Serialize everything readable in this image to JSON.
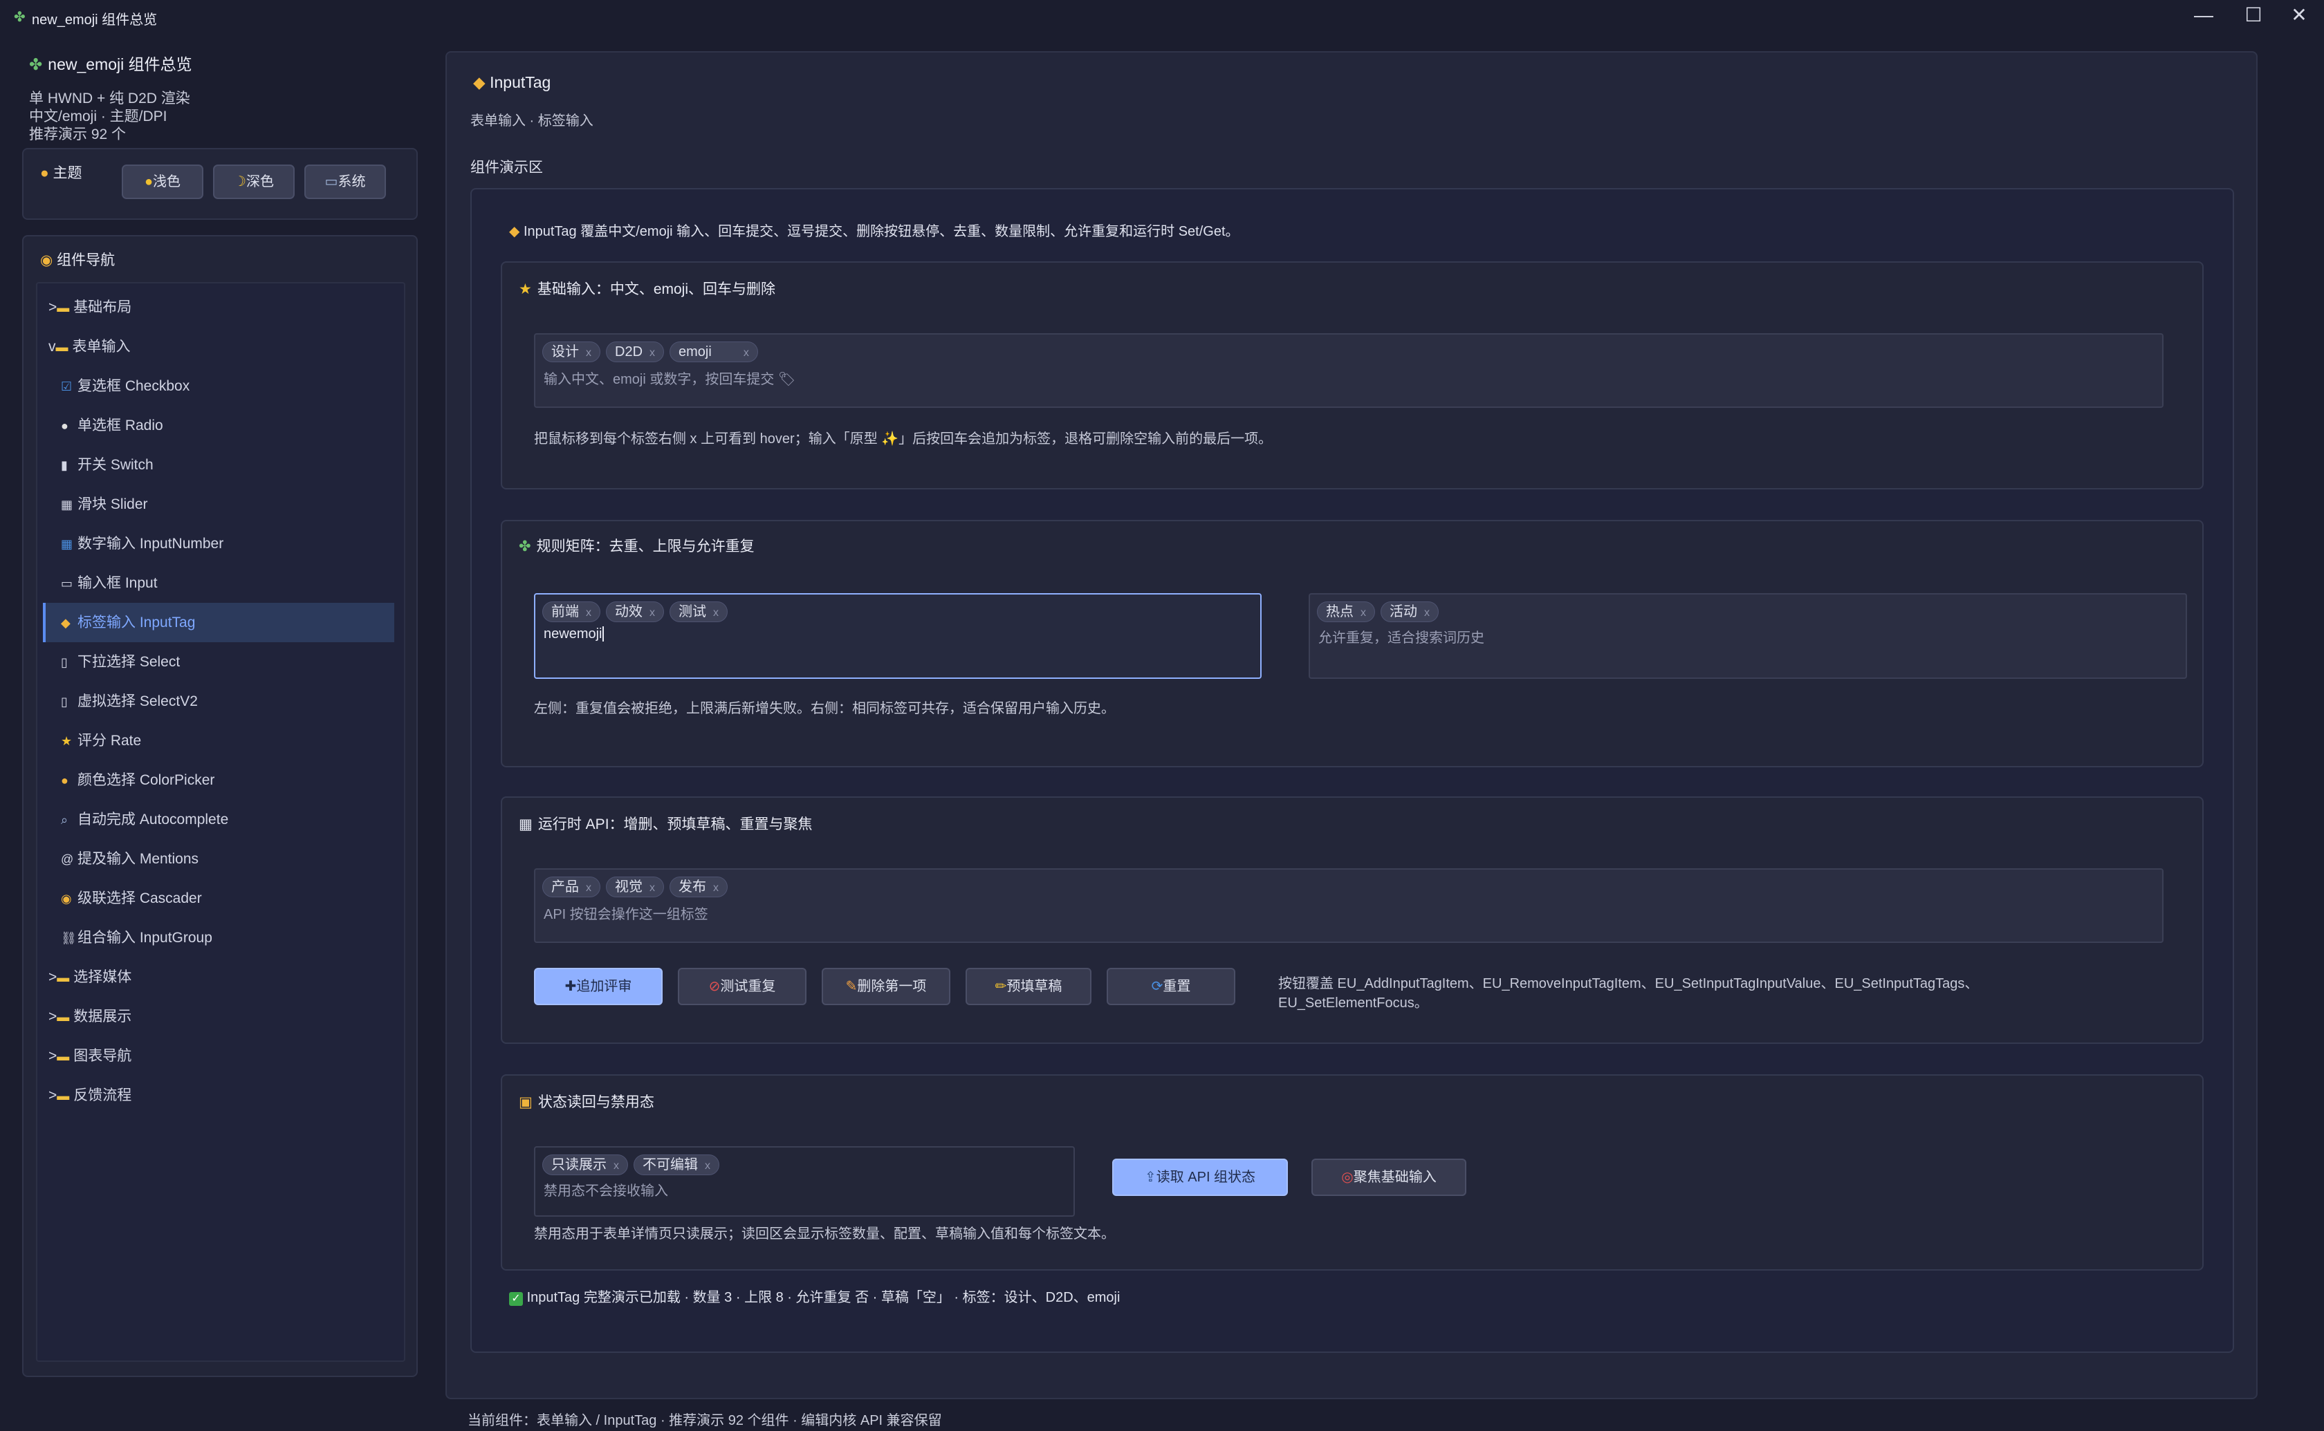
{
  "window": {
    "title": "new_emoji 组件总览",
    "minimize": "—",
    "maximize": "☐",
    "close": "✕"
  },
  "sidebar": {
    "app_title": "new_emoji 组件总览",
    "info_lines": [
      "单 HWND + 纯 D2D 渲染",
      "中文/emoji · 主题/DPI",
      "推荐演示 92 个"
    ],
    "theme": {
      "label": "主题",
      "buttons": [
        "浅色",
        "深色",
        "系统"
      ]
    },
    "nav": {
      "label": "组件导航",
      "items": [
        {
          "prefix": ">",
          "icon": "📁",
          "label": "基础布局"
        },
        {
          "prefix": "v",
          "icon": "📁",
          "label": "表单输入"
        },
        {
          "icon": "☑",
          "label": "复选框 Checkbox"
        },
        {
          "icon": "⚪",
          "label": "单选框 Radio"
        },
        {
          "icon": "▮",
          "label": "开关 Switch"
        },
        {
          "icon": "▦",
          "label": "滑块 Slider"
        },
        {
          "icon": "🔢",
          "label": "数字输入 InputNumber"
        },
        {
          "icon": "▭",
          "label": "输入框 Input"
        },
        {
          "icon": "🏷",
          "label": "标签输入 InputTag"
        },
        {
          "icon": "▯",
          "label": "下拉选择 Select"
        },
        {
          "icon": "▯",
          "label": "虚拟选择 SelectV2"
        },
        {
          "icon": "★",
          "label": "评分 Rate"
        },
        {
          "icon": "🎨",
          "label": "颜色选择 ColorPicker"
        },
        {
          "icon": "🔎",
          "label": "自动完成 Autocomplete"
        },
        {
          "icon": "@",
          "label": "提及输入 Mentions"
        },
        {
          "icon": "🧭",
          "label": "级联选择 Cascader"
        },
        {
          "icon": "🔗",
          "label": "组合输入 InputGroup"
        },
        {
          "prefix": ">",
          "icon": "📁",
          "label": "选择媒体"
        },
        {
          "prefix": ">",
          "icon": "📁",
          "label": "数据展示"
        },
        {
          "prefix": ">",
          "icon": "📁",
          "label": "图表导航"
        },
        {
          "prefix": ">",
          "icon": "📁",
          "label": "反馈流程"
        }
      ]
    }
  },
  "main": {
    "title": "InputTag",
    "subtitle": "表单输入 · 标签输入",
    "demo_label": "组件演示区",
    "intro": "InputTag 覆盖中文/emoji 输入、回车提交、逗号提交、删除按钮悬停、去重、数量限制、允许重复和运行时 Set/Get。",
    "sections": {
      "basic": {
        "title": "基础输入：中文、emoji、回车与删除",
        "tags": [
          "设计",
          "D2D",
          "emoji"
        ],
        "placeholder": "输入中文、emoji 或数字，按回车提交 🏷",
        "hint": "把鼠标移到每个标签右侧 x 上可看到 hover；输入「原型 ✨」后按回车会追加为标签，退格可删除空输入前的最后一项。"
      },
      "rules": {
        "title": "规则矩阵：去重、上限与允许重复",
        "left_tags": [
          "前端",
          "动效",
          "测试"
        ],
        "left_value": "newemoji",
        "right_tags": [
          "热点",
          "活动"
        ],
        "right_placeholder": "允许重复，适合搜索词历史",
        "hint": "左侧：重复值会被拒绝，上限满后新增失败。右侧：相同标签可共存，适合保留用户输入历史。"
      },
      "api": {
        "title": "运行时 API：增删、预填草稿、重置与聚焦",
        "tags": [
          "产品",
          "视觉",
          "发布"
        ],
        "placeholder": "API 按钮会操作这一组标签",
        "buttons": [
          "追加评审",
          "测试重复",
          "删除第一项",
          "预填草稿",
          "重置"
        ],
        "note_line1": "按钮覆盖 EU_AddInputTagItem、EU_RemoveInputTagItem、EU_SetInputTagInputValue、EU_SetInputTagTags、",
        "note_line2": "EU_SetElementFocus。"
      },
      "state": {
        "title": "状态读回与禁用态",
        "tags": [
          "只读展示",
          "不可编辑"
        ],
        "placeholder": "禁用态不会接收输入",
        "read_button": "读取 API 组状态",
        "focus_button": "聚焦基础输入",
        "hint": "禁用态用于表单详情页只读展示；读回区会显示标签数量、配置、草稿输入值和每个标签文本。"
      }
    },
    "status": "InputTag 完整演示已加载 · 数量 3 · 上限 8 · 允许重复 否 · 草稿「空」 · 标签：设计、D2D、emoji"
  },
  "footer": "当前组件：表单输入 / InputTag · 推荐演示 92 个组件 · 编辑内核 API 兼容保留"
}
